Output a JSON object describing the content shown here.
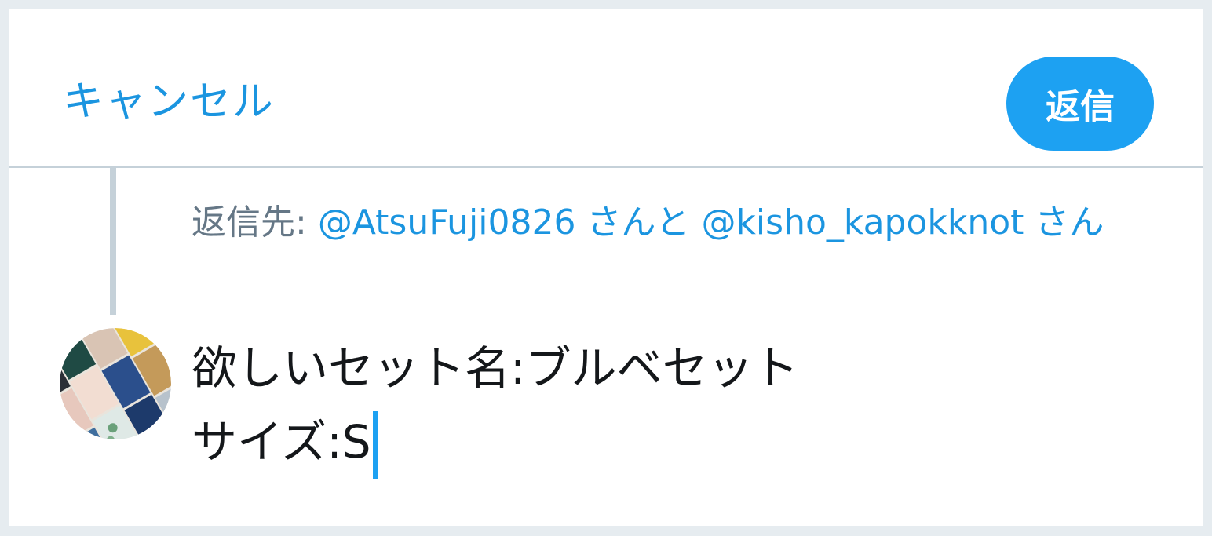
{
  "header": {
    "cancel_label": "キャンセル",
    "reply_label": "返信"
  },
  "reply_to": {
    "prefix": "返信先:",
    "user1": "@AtsuFuji0826",
    "joiner": "さんと",
    "user2": "@kisho_kapokknot",
    "suffix": "さん"
  },
  "composer": {
    "line1": "欲しいセット名:ブルベセット",
    "line2": "サイズ:S"
  },
  "colors": {
    "accent": "#1da1f2",
    "link": "#1b95e0",
    "muted_text": "#657786",
    "divider": "#c5d1d9",
    "background": "#e6ecf0"
  },
  "icons": {
    "avatar": "avatar-image"
  }
}
